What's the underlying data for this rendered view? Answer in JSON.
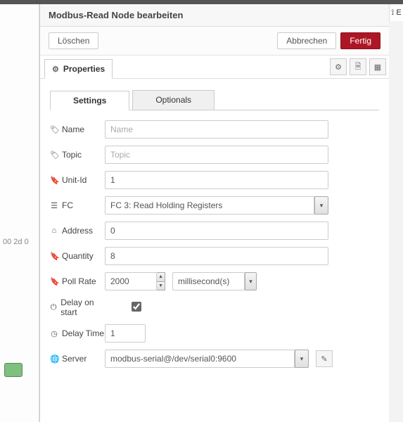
{
  "bg": {
    "time": "00 2d 0"
  },
  "rightStrip": "⟟ E",
  "dialog": {
    "title": "Modbus-Read Node bearbeiten",
    "delete": "Löschen",
    "cancel": "Abbrechen",
    "done": "Fertig"
  },
  "sectionTab": "Properties",
  "tabs": {
    "settings": "Settings",
    "optionals": "Optionals"
  },
  "labels": {
    "name": "Name",
    "topic": "Topic",
    "unitId": "Unit-Id",
    "fc": "FC",
    "address": "Address",
    "quantity": "Quantity",
    "pollRate": "Poll Rate",
    "delayStart": "Delay on start",
    "delayTime": "Delay Time",
    "server": "Server"
  },
  "placeholders": {
    "name": "Name",
    "topic": "Topic"
  },
  "values": {
    "unitId": "1",
    "fc": "FC 3: Read Holding Registers",
    "address": "0",
    "quantity": "8",
    "pollRate": "2000",
    "pollUnit": "millisecond(s)",
    "delayStart": true,
    "delayTime": "1",
    "server": "modbus-serial@/dev/serial0:9600"
  }
}
